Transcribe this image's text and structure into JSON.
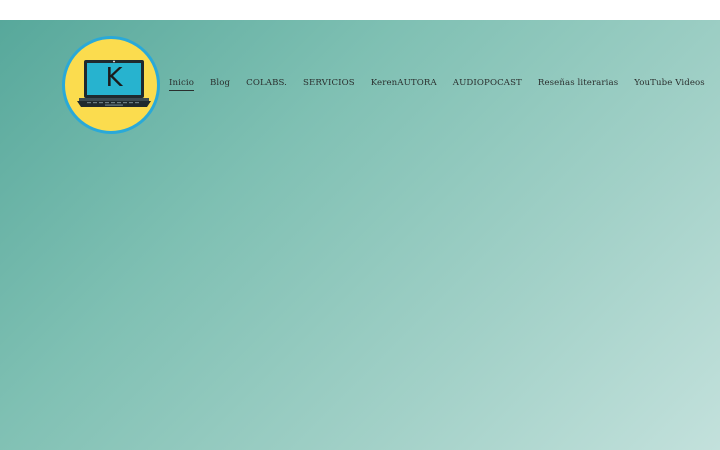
{
  "logo": {
    "letter": "K",
    "icon": "laptop-icon"
  },
  "nav": {
    "items": [
      {
        "label": "Inicio",
        "active": true
      },
      {
        "label": "Blog"
      },
      {
        "label": "COLABS."
      },
      {
        "label": "SERVICIOS"
      },
      {
        "label": "KerenAUTORA"
      },
      {
        "label": "AUDIOPOCAST"
      },
      {
        "label": "Reseñas literarias"
      },
      {
        "label": "YouTube Videos"
      }
    ]
  },
  "colors": {
    "hero_start": "#57a89b",
    "hero_end": "#c3e1dc",
    "logo_fill": "#fbdc4e",
    "logo_ring": "#2aa9d8",
    "laptop_screen": "#27b3cf"
  }
}
